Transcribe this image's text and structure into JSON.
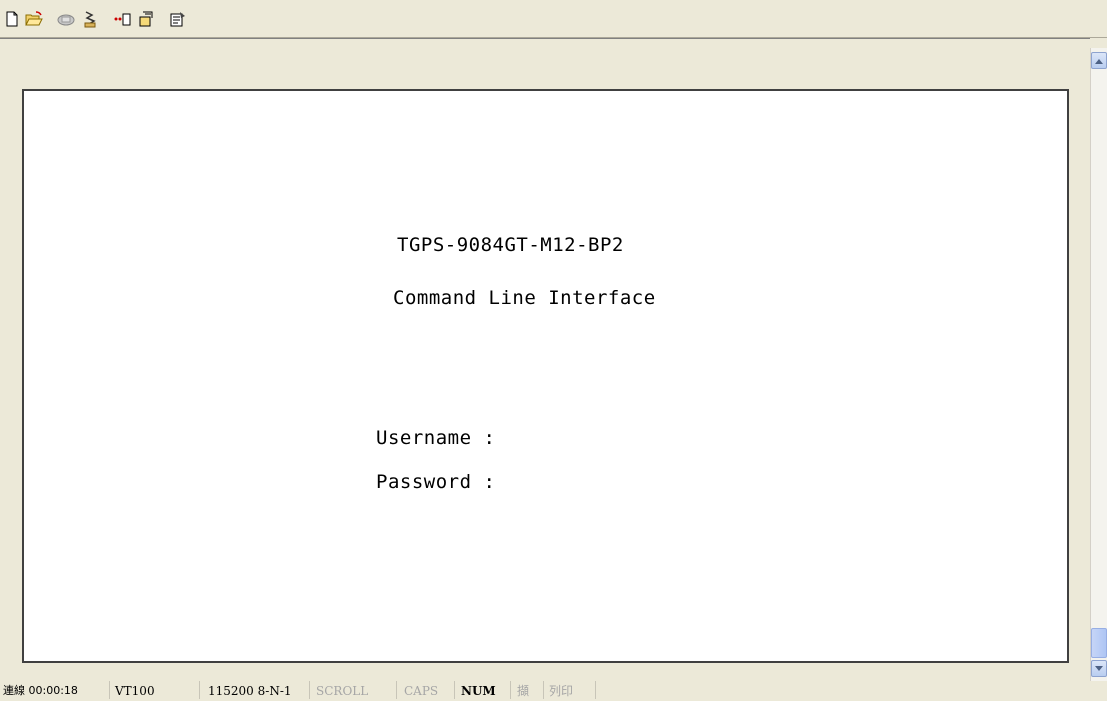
{
  "toolbar": {
    "buttons": [
      {
        "icon": "new-document-icon"
      },
      {
        "icon": "open-folder-icon"
      },
      {
        "icon": "connect-phone-icon"
      },
      {
        "icon": "disconnect-icon"
      },
      {
        "icon": "send-icon"
      },
      {
        "icon": "receive-icon"
      },
      {
        "icon": "properties-icon"
      }
    ]
  },
  "terminal": {
    "line1": "TGPS-9084GT-M12-BP2",
    "line2": "Command Line Interface",
    "username_label": "Username :",
    "password_label": "Password :"
  },
  "statusbar": {
    "connection": "連線 00:00:18",
    "emulation": "VT100",
    "port_settings": "115200 8-N-1",
    "scroll": "SCROLL",
    "caps": "CAPS",
    "num": "NUM",
    "capture": "擷",
    "print": "列印"
  }
}
